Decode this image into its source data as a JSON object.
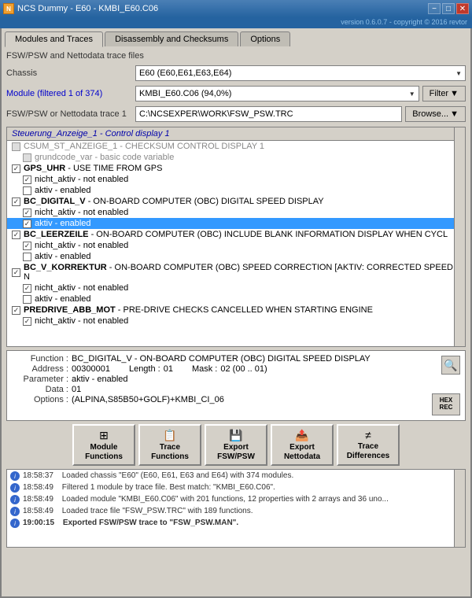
{
  "titlebar": {
    "icon": "N",
    "title": "NCS Dummy - E60 - KMBI_E60.C06",
    "buttons": [
      "−",
      "□",
      "✕"
    ],
    "version": "version 0.6.0.7 - copyright © 2016 revtor"
  },
  "tabs": [
    {
      "id": "modules-traces",
      "label": "Modules and Traces",
      "active": true
    },
    {
      "id": "disassembly",
      "label": "Disassembly and Checksums",
      "active": false
    },
    {
      "id": "options",
      "label": "Options",
      "active": false
    }
  ],
  "form": {
    "section_label": "FSW/PSW and Nettodata trace files",
    "chassis_label": "Chassis",
    "chassis_value": "E60  (E60,E61,E63,E64)",
    "module_label": "Module (filtered 1 of 374)",
    "module_value": "KMBI_E60.C06  (94,0%)",
    "filter_label": "Filter",
    "trace_label": "FSW/PSW or Nettodata trace 1",
    "trace_value": "C:\\NCSEXPER\\WORK\\FSW_PSW.TRC",
    "browse_label": "Browse..."
  },
  "tree": {
    "header": "Steuerung_Anzeige_1 - Control display 1",
    "items": [
      {
        "id": "csum",
        "text": "CSUM_ST_ANZEIGE_1 - CHECKSUM CONTROL DISPLAY 1",
        "checked": false,
        "enabled": false,
        "indent": 0
      },
      {
        "id": "grundcode",
        "text": "grundcode_var - basic code variable",
        "checked": false,
        "enabled": false,
        "indent": 1
      },
      {
        "id": "gps_uhr",
        "text": "GPS_UHR - USE TIME FROM GPS",
        "checked": true,
        "enabled": true,
        "indent": 0,
        "bold": true
      },
      {
        "id": "gps_nicht",
        "text": "nicht_aktiv - not enabled",
        "checked": true,
        "enabled": true,
        "indent": 1
      },
      {
        "id": "gps_aktiv",
        "text": "aktiv - enabled",
        "checked": false,
        "enabled": true,
        "indent": 1
      },
      {
        "id": "bc_digital",
        "text": "BC_DIGITAL_V - ON-BOARD COMPUTER (OBC) DIGITAL SPEED DISPLAY",
        "checked": true,
        "enabled": true,
        "indent": 0,
        "bold": true
      },
      {
        "id": "bc_nicht",
        "text": "nicht_aktiv - not enabled",
        "checked": true,
        "enabled": true,
        "indent": 1
      },
      {
        "id": "bc_aktiv",
        "text": "aktiv - enabled",
        "checked": true,
        "enabled": true,
        "indent": 1,
        "selected": true
      },
      {
        "id": "leer",
        "text": "BC_LEERZEILE - ON-BOARD COMPUTER (OBC) INCLUDE BLANK INFORMATION DISPLAY WHEN CYCL",
        "checked": true,
        "enabled": true,
        "indent": 0,
        "bold": true
      },
      {
        "id": "leer_nicht",
        "text": "nicht_aktiv - not enabled",
        "checked": true,
        "enabled": true,
        "indent": 1
      },
      {
        "id": "leer_aktiv",
        "text": "aktiv - enabled",
        "checked": false,
        "enabled": true,
        "indent": 1
      },
      {
        "id": "korr",
        "text": "BC_V_KORREKTUR - ON-BOARD COMPUTER (OBC) SPEED CORRECTION [AKTIV: CORRECTED SPEED, N",
        "checked": true,
        "enabled": true,
        "indent": 0,
        "bold": true
      },
      {
        "id": "korr_nicht",
        "text": "nicht_aktiv - not enabled",
        "checked": true,
        "enabled": true,
        "indent": 1
      },
      {
        "id": "korr_aktiv",
        "text": "aktiv - enabled",
        "checked": false,
        "enabled": true,
        "indent": 1
      },
      {
        "id": "predrive",
        "text": "PREDRIVE_ABB_MOT - PRE-DRIVE CHECKS CANCELLED WHEN STARTING ENGINE",
        "checked": true,
        "enabled": true,
        "indent": 0,
        "bold": true
      },
      {
        "id": "predrive_nicht",
        "text": "nicht_aktiv - not enabled",
        "checked": true,
        "enabled": true,
        "indent": 1
      }
    ]
  },
  "info": {
    "function_label": "Function :",
    "function_value": "BC_DIGITAL_V - ON-BOARD COMPUTER (OBC) DIGITAL SPEED DISPLAY",
    "address_label": "Address :",
    "address_value": "00300001",
    "length_label": "Length :",
    "length_value": "01",
    "mask_label": "Mask :",
    "mask_value": "02  (00 .. 01)",
    "parameter_label": "Parameter :",
    "parameter_value": "aktiv - enabled",
    "data_label": "Data :",
    "data_value": "01",
    "options_label": "Options :",
    "options_value": "(ALPINA,S85B50+GOLF)+KMBI_CI_06",
    "hex_btn_label1": "HEX",
    "hex_btn_label2": "REC"
  },
  "buttons": [
    {
      "id": "module-functions",
      "line1": "Module",
      "line2": "Functions"
    },
    {
      "id": "trace-functions",
      "line1": "Trace",
      "line2": "Functions"
    },
    {
      "id": "export-fsw",
      "line1": "Export",
      "line2": "FSW/PSW"
    },
    {
      "id": "export-netto",
      "line1": "Export",
      "line2": "Nettodata"
    },
    {
      "id": "trace-diff",
      "line1": "Trace",
      "line2": "Differences"
    }
  ],
  "log": {
    "items": [
      {
        "time": "18:58:37",
        "text": "Loaded chassis \"E60\" (E60, E61, E63 and E64) with 374 modules."
      },
      {
        "time": "18:58:49",
        "text": "Filtered 1 module by trace file. Best match: \"KMBI_E60.C06\"."
      },
      {
        "time": "18:58:49",
        "text": "Loaded module \"KMBI_E60.C06\" with 201 functions, 12 properties with 2 arrays and 36 uno..."
      },
      {
        "time": "18:58:49",
        "text": "Loaded trace file \"FSW_PSW.TRC\" with 189 functions."
      },
      {
        "time": "19:00:15",
        "text": "Exported FSW/PSW trace to \"FSW_PSW.MAN\".",
        "bold": true
      }
    ]
  }
}
